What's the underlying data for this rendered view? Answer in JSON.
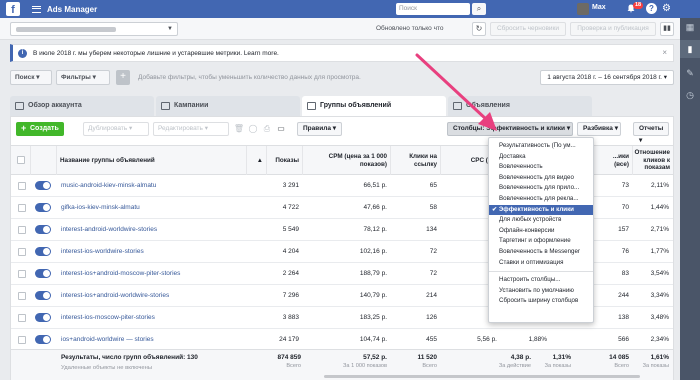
{
  "topbar": {
    "logo": "f",
    "title": "Ads Manager",
    "search_placeholder": "Поиск",
    "user": "Max",
    "notifications": "18",
    "help": "?",
    "colors": {
      "bar": "#4267b2",
      "badge": "#fa3e3e"
    }
  },
  "subbar": {
    "saved_text": "Обновлено только что",
    "discard_label": "Сбросить черновики",
    "review_label": "Проверка и публикация"
  },
  "banner": {
    "text": "В июле 2018 г. мы уберем некоторые лишние и устаревшие метрики. Learn more.",
    "icon": "i"
  },
  "filterbar": {
    "search_label": "Поиск ▾",
    "filters_label": "Фильтры ▾",
    "hint": "Добавьте фильтры, чтобы уменьшить количество данных для просмотра.",
    "date_range": "1 августа 2018 г. – 16 сентября 2018 г. ▾"
  },
  "tabs": [
    {
      "label": "Обзор аккаунта"
    },
    {
      "label": "Кампании"
    },
    {
      "label": "Группы объявлений"
    },
    {
      "label": "Объявления"
    }
  ],
  "toolbar": {
    "create": "Создать",
    "duplicate": "Дублировать ▾",
    "edit": "Редактировать ▾",
    "rules": "Правила ▾",
    "columns": "Столбцы: Эффективность и клики ▾",
    "breakdown": "Разбивка ▾",
    "reports": "Отчеты ▾",
    "accent": "#42b72a"
  },
  "table": {
    "headers": {
      "name": "Название группы объявлений",
      "impressions": "Показы",
      "cpm": "CPM (цена за 1 000 показов)",
      "link_clicks": "Клики на ссылку",
      "cpc": "CPC (ц...",
      "clicks_all": "...ики (все)",
      "rate": "Отношение кликов к показам"
    },
    "rows": [
      {
        "name": "music-android-kiev-minsk-almatu",
        "impressions": "3 291",
        "cpm": "66,51 р.",
        "link_clicks": "65",
        "clicks_all": "73",
        "rate": "2,11%"
      },
      {
        "name": "gifka-ios-kiev-minsk-almatu",
        "impressions": "4 722",
        "cpm": "47,66 р.",
        "link_clicks": "58",
        "clicks_all": "70",
        "rate": "1,44%"
      },
      {
        "name": "interest-android-worldwire-stories",
        "impressions": "5 549",
        "cpm": "78,12 р.",
        "link_clicks": "134",
        "clicks_all": "157",
        "rate": "2,71%"
      },
      {
        "name": "interest-ios-worldwire-stories",
        "impressions": "4 204",
        "cpm": "102,16 р.",
        "link_clicks": "72",
        "clicks_all": "76",
        "rate": "1,77%"
      },
      {
        "name": "interest-ios+android-moscow-piter-stories",
        "impressions": "2 264",
        "cpm": "188,79 р.",
        "link_clicks": "72",
        "clicks_all": "83",
        "rate": "3,54%"
      },
      {
        "name": "interest-ios+android-worldwire-stories",
        "impressions": "7 296",
        "cpm": "140,79 р.",
        "link_clicks": "214",
        "clicks_all": "244",
        "rate": "3,34%"
      },
      {
        "name": "interest-ios-moscow-piter-stories",
        "impressions": "3 883",
        "cpm": "183,25 р.",
        "link_clicks": "126",
        "clicks_all": "138",
        "rate": "3,48%"
      },
      {
        "name": "ios+android-worldwire — stories",
        "impressions": "24 179",
        "cpm": "104,74 р.",
        "link_clicks": "455",
        "cpc": "5,56 р.",
        "ctr": "1,88%",
        "clicks_all": "566",
        "rate": "2,34%"
      }
    ],
    "totals": {
      "label": "Результаты, число групп объявлений: 130",
      "sub": "Удаленные объекты не включены",
      "impressions": "874 859",
      "impressions_sub": "Всего",
      "cpm": "57,52 р.",
      "cpm_sub": "За 1 000 показов",
      "link_clicks": "11 520",
      "link_clicks_sub": "Всего",
      "cpc": "4,38 р.",
      "cpc_sub": "За действие",
      "ctr": "1,31%",
      "ctr_sub": "За показы",
      "clicks_all": "14 085",
      "clicks_all_sub": "Всего",
      "rate": "1,61%",
      "rate_sub": "За показы"
    }
  },
  "columns_menu": {
    "items": [
      "Результативность (По ум...",
      "Доставка",
      "Вовлеченность",
      "Вовлеченность для видео",
      "Вовлеченность для прило...",
      "Вовлеченность для рекла...",
      "Эффективность и клики",
      "Для любых устройств",
      "Офлайн-конверсии",
      "Таргетинг и оформление",
      "Вовлеченность в Messenger",
      "Ставки и оптимизация"
    ],
    "selected": "✔ Эффективность и клики",
    "actions": [
      "Настроить столбцы...",
      "Установить по умолчанию",
      "Сбросить ширину столбцов"
    ]
  }
}
